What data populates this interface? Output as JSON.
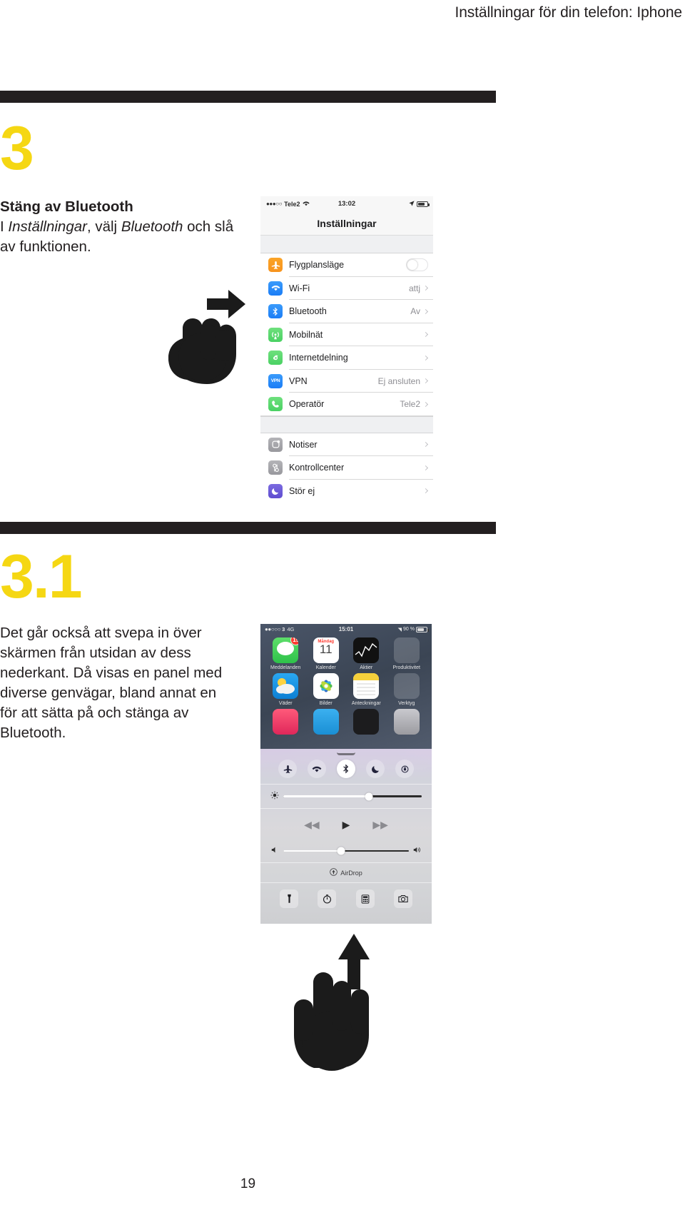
{
  "running_header": {
    "text": "Inställningar för din telefon: Iphone"
  },
  "page_number": "19",
  "steps": [
    {
      "number": "3",
      "title": "Stäng av Bluetooth",
      "body_line1_pre": "I ",
      "body_line1_em1": "Inställningar",
      "body_line1_mid": ", välj ",
      "body_line1_em2": "Bluetooth",
      "body_line2": "och slå av funktionen."
    },
    {
      "number": "3.1",
      "body": "Det går också att svepa in över skärmen från utsidan av dess nederkant. Då visas en panel med diverse genvägar, bland annat en för att sätta på och stänga av Bluetooth."
    }
  ],
  "phone_settings": {
    "status_bar": {
      "signal_dots": "●●●○○",
      "carrier": "Tele2",
      "wifi_icon": "wifi-icon",
      "time": "13:02",
      "location_icon": "location-arrow-icon",
      "battery_icon": "battery-icon"
    },
    "nav_title": "Inställningar",
    "group1": [
      {
        "label": "Flygplansläge",
        "value": "",
        "icon": "airplane-icon",
        "icon_color": "#F7931E",
        "control": "toggle",
        "toggle_on": false
      },
      {
        "label": "Wi-Fi",
        "value": "attj",
        "icon": "wifi-icon",
        "icon_color": "#1B7DF6",
        "control": "chevron"
      },
      {
        "label": "Bluetooth",
        "value": "Av",
        "icon": "bluetooth-icon",
        "icon_color": "#1B7DF6",
        "control": "chevron"
      },
      {
        "label": "Mobilnät",
        "value": "",
        "icon": "cellular-icon",
        "icon_color": "#4AD163",
        "control": "chevron"
      },
      {
        "label": "Internetdelning",
        "value": "",
        "icon": "hotspot-icon",
        "icon_color": "#4AD163",
        "control": "chevron"
      },
      {
        "label": "VPN",
        "value": "Ej ansluten",
        "icon": "vpn-icon",
        "icon_color": "#1B7DF6",
        "control": "chevron"
      },
      {
        "label": "Operatör",
        "value": "Tele2",
        "icon": "phone-icon",
        "icon_color": "#4AD163",
        "control": "chevron"
      }
    ],
    "group2": [
      {
        "label": "Notiser",
        "value": "",
        "icon": "notifications-icon",
        "icon_color": "#98989D",
        "control": "chevron"
      },
      {
        "label": "Kontrollcenter",
        "value": "",
        "icon": "control-center-icon",
        "icon_color": "#98989D",
        "control": "chevron"
      },
      {
        "label": "Stör ej",
        "value": "",
        "icon": "moon-icon",
        "icon_color": "#5F4DD0",
        "control": "chevron"
      }
    ]
  },
  "phone_control_center": {
    "status_bar": {
      "signal_dots": "●●○○○",
      "carrier": "3",
      "network": "4G",
      "time": "15:01",
      "location_icon": "location-arrow-icon",
      "battery_text": "90 %"
    },
    "home_apps": [
      {
        "label": "Meddelanden",
        "icon": "messages-icon",
        "badge": "19"
      },
      {
        "label": "Kalender",
        "icon": "calendar-icon",
        "cal_day": "Måndag",
        "cal_num": "11"
      },
      {
        "label": "Aktier",
        "icon": "stocks-icon"
      },
      {
        "label": "Produktivitet",
        "icon": "folder-icon"
      },
      {
        "label": "Väder",
        "icon": "weather-icon"
      },
      {
        "label": "Bilder",
        "icon": "photos-icon"
      },
      {
        "label": "Anteckningar",
        "icon": "notes-icon"
      },
      {
        "label": "Verktyg",
        "icon": "folder-icon"
      }
    ],
    "toggles": [
      {
        "name": "airplane-mode-toggle",
        "glyph": "✈",
        "on": false
      },
      {
        "name": "wifi-toggle",
        "glyph": "◗",
        "on": false
      },
      {
        "name": "bluetooth-toggle",
        "glyph": "✳",
        "on": true
      },
      {
        "name": "do-not-disturb-toggle",
        "glyph": "☾",
        "on": false
      },
      {
        "name": "rotation-lock-toggle",
        "glyph": "⟳",
        "on": false
      }
    ],
    "brightness": {
      "icon": "brightness-icon",
      "value_percent": 62
    },
    "media": {
      "prev": "◀◀",
      "play": "▶",
      "next": "▶▶"
    },
    "volume": {
      "icon": "volume-icon",
      "value_percent": 46
    },
    "airdrop": {
      "icon": "airdrop-icon",
      "label": "AirDrop"
    },
    "shortcuts": [
      {
        "name": "flashlight-shortcut",
        "glyph": "🔦"
      },
      {
        "name": "timer-shortcut",
        "glyph": "◷"
      },
      {
        "name": "calculator-shortcut",
        "glyph": "▦"
      },
      {
        "name": "camera-shortcut",
        "glyph": "▣"
      }
    ]
  },
  "hands": [
    {
      "name": "hand-pointing-right",
      "direction": "right"
    },
    {
      "name": "hand-swipe-up",
      "direction": "up"
    }
  ],
  "colors": {
    "accent_yellow": "#F5D713",
    "rule_black": "#231F20",
    "text": "#231F20"
  }
}
